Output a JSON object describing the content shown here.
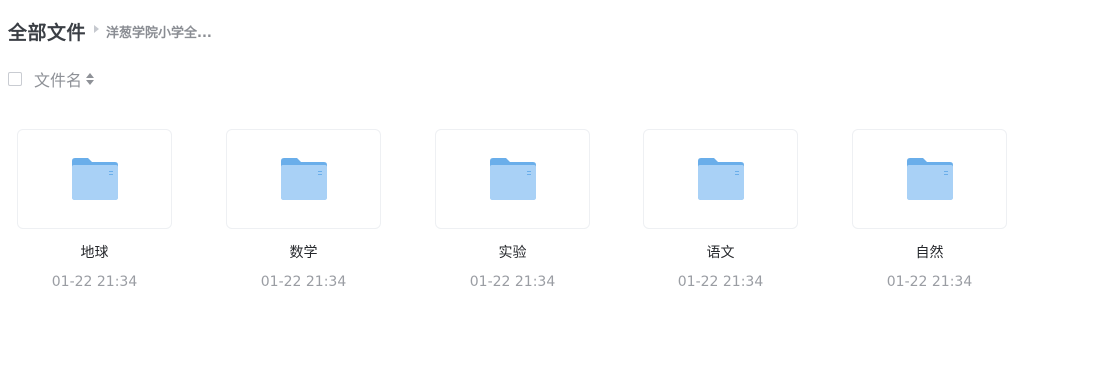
{
  "breadcrumb": {
    "root": "全部文件",
    "current": "洋葱学院小学全..."
  },
  "sort": {
    "label": "文件名"
  },
  "colors": {
    "folder_tab": "#6aaeea",
    "folder_front": "#a9d1f6"
  },
  "files": [
    {
      "name": "地球",
      "time": "01-22 21:34",
      "icon": "folder-icon"
    },
    {
      "name": "数学",
      "time": "01-22 21:34",
      "icon": "folder-icon"
    },
    {
      "name": "实验",
      "time": "01-22 21:34",
      "icon": "folder-icon"
    },
    {
      "name": "语文",
      "time": "01-22 21:34",
      "icon": "folder-icon"
    },
    {
      "name": "自然",
      "time": "01-22 21:34",
      "icon": "folder-icon"
    }
  ]
}
